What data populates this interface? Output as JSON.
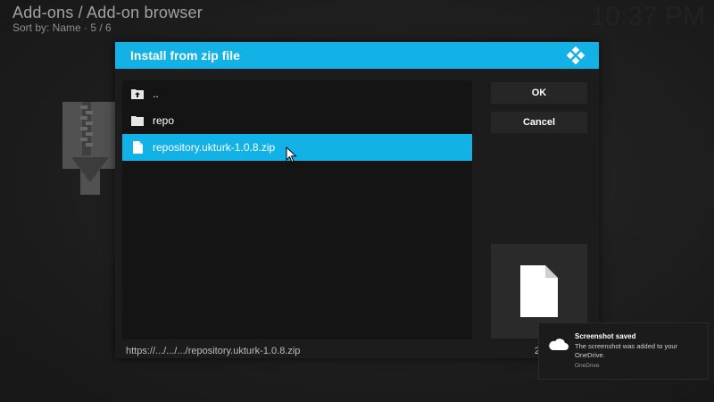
{
  "header": {
    "title": "Add-ons / Add-on browser",
    "subtitle": "Sort by: Name  ·  5 / 6",
    "clock": "10:37 PM"
  },
  "dialog": {
    "title": "Install from zip file",
    "logo_icon": "kodi-logo-icon",
    "items": [
      {
        "label": "..",
        "icon": "folder-up-icon",
        "selected": false
      },
      {
        "label": "repo",
        "icon": "folder-icon",
        "selected": false
      },
      {
        "label": "repository.ukturk-1.0.8.zip",
        "icon": "file-icon",
        "selected": true
      }
    ],
    "buttons": {
      "ok": "OK",
      "cancel": "Cancel"
    },
    "path": "https://.../.../.../repository.ukturk-1.0.8.zip",
    "page_indicator": "2",
    "preview_icon": "file-icon"
  },
  "toast": {
    "title": "Screenshot saved",
    "body": "The screenshot was added to your OneDrive.",
    "source": "OneDrive",
    "icon": "onedrive-cloud-icon"
  },
  "colors": {
    "accent": "#12b2e7",
    "dialog_bg": "#1c1c1c",
    "list_bg": "#141414"
  }
}
